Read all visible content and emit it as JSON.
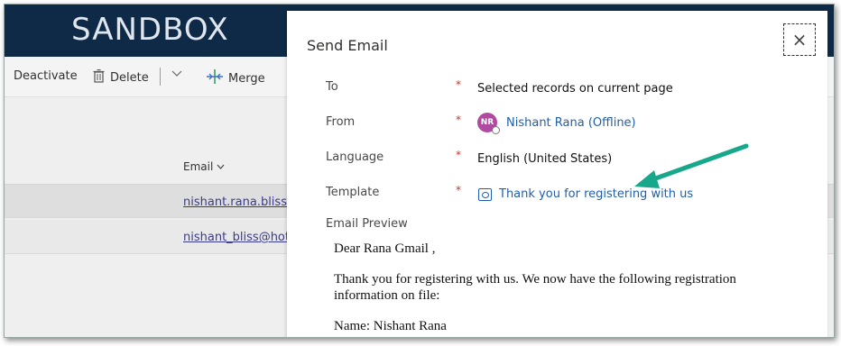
{
  "app": {
    "title": "SANDBOX"
  },
  "commandbar": {
    "deactivate_label": "Deactivate",
    "delete_label": "Delete",
    "merge_label": "Merge"
  },
  "grid": {
    "email_header": "Email",
    "rows": [
      "nishant.rana.bliss@",
      "nishant_bliss@hot"
    ]
  },
  "dialog": {
    "title": "Send Email",
    "close_symbol": "×",
    "fields": {
      "to": {
        "label": "To",
        "required": "*",
        "value": "Selected records on current page"
      },
      "from": {
        "label": "From",
        "required": "*",
        "avatar_initials": "NR",
        "value": "Nishant Rana (Offline)"
      },
      "language": {
        "label": "Language",
        "required": "*",
        "value": "English (United States)"
      },
      "template": {
        "label": "Template",
        "required": "*",
        "value": "Thank you for registering with us"
      }
    },
    "preview": {
      "label": "Email Preview",
      "greeting": "Dear Rana Gmail ,",
      "body": "Thank you for registering with us. We now have the following registration information on file:",
      "name_line": "Name: Nishant Rana"
    }
  },
  "colors": {
    "header_bg": "#0e2a47",
    "link": "#1d5fae",
    "required": "#c0392b",
    "avatar": "#b04aa1",
    "arrow": "#17a88c"
  }
}
